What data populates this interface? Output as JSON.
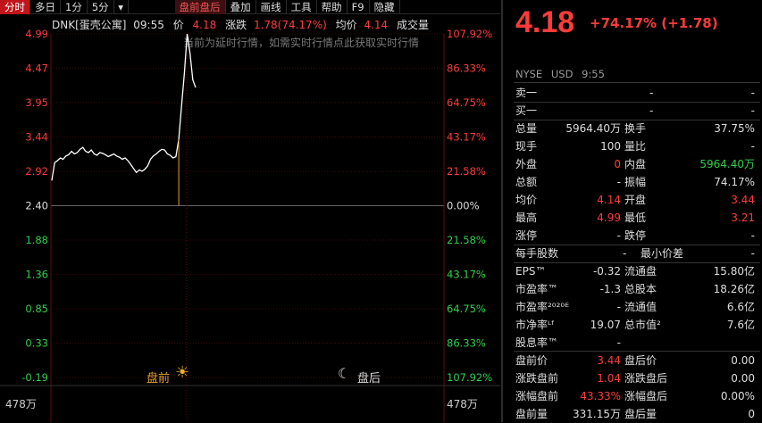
{
  "toolbar": {
    "items": [
      "分时",
      "多日",
      "1分",
      "5分",
      "",
      "盘前盘后",
      "叠加",
      "画线",
      "工具",
      "帮助",
      "F9",
      "隐藏"
    ]
  },
  "chart": {
    "symbol": "DNK[蛋壳公寓]",
    "time": "09:55",
    "price_label": "价",
    "price": "4.18",
    "change_label": "涨跌",
    "change": "1.78(74.17%)",
    "avg_label": "均价",
    "avg": "4.14",
    "vol_label": "成交量",
    "notice": "当前为延时行情，如需实时行情点此获取实时行情",
    "premarket_label": "盘前",
    "afterhours_label": "盘后",
    "vol_max_left": "478万",
    "vol_max_right": "478万",
    "left_ticks": [
      "4.99",
      "4.47",
      "3.95",
      "3.44",
      "2.92",
      "2.40",
      "1.88",
      "1.36",
      "0.85",
      "0.33",
      "-0.19"
    ],
    "right_ticks": [
      "107.92%",
      "86.33%",
      "64.75%",
      "43.17%",
      "21.58%",
      "0.00%",
      "21.58%",
      "43.17%",
      "64.75%",
      "86.33%",
      "107.92%"
    ]
  },
  "chart_data": {
    "type": "line",
    "yrange": [
      -0.19,
      4.99
    ],
    "prev_close": 2.4,
    "series": [
      {
        "values": [
          2.78,
          3.05,
          3.08,
          3.12,
          3.1,
          3.15,
          3.17,
          3.22,
          3.18,
          3.2,
          3.25,
          3.28,
          3.22,
          3.2,
          3.24,
          3.18,
          3.16,
          3.2,
          3.19,
          3.17,
          3.14,
          3.16,
          3.18,
          3.15,
          3.13,
          3.1,
          3.12,
          3.08,
          3.02,
          2.96,
          2.9,
          2.94,
          2.92,
          2.95,
          3.0,
          3.1,
          3.15,
          3.18,
          3.22,
          3.25,
          3.24,
          3.18,
          3.16,
          3.12,
          3.14,
          3.4,
          3.9,
          4.4,
          4.99,
          4.7,
          4.3,
          4.18
        ]
      }
    ]
  },
  "quote": {
    "price": "4.18",
    "change": "+74.17% (+1.78)",
    "exchange": "NYSE",
    "currency": "USD",
    "time": "9:55",
    "sell1_label": "卖一",
    "sell1_a": "-",
    "sell1_b": "-",
    "buy1_label": "买一",
    "buy1_a": "-",
    "buy1_b": "-",
    "rows": [
      {
        "l1": "总量",
        "v1": "5964.40万",
        "c1": "white",
        "l2": "换手",
        "v2": "37.75%",
        "c2": "white"
      },
      {
        "l1": "现手",
        "v1": "100",
        "c1": "white",
        "l2": "量比",
        "v2": "-",
        "c2": "white"
      },
      {
        "l1": "外盘",
        "v1": "0",
        "c1": "red",
        "l2": "内盘",
        "v2": "5964.40万",
        "c2": "green"
      },
      {
        "l1": "总额",
        "v1": "-",
        "c1": "white",
        "l2": "振幅",
        "v2": "74.17%",
        "c2": "white"
      },
      {
        "l1": "均价",
        "v1": "4.14",
        "c1": "red",
        "l2": "开盘",
        "v2": "3.44",
        "c2": "red"
      },
      {
        "l1": "最高",
        "v1": "4.99",
        "c1": "red",
        "l2": "最低",
        "v2": "3.21",
        "c2": "red"
      },
      {
        "l1": "涨停",
        "v1": "-",
        "c1": "white",
        "l2": "跌停",
        "v2": "-",
        "c2": "white"
      }
    ],
    "lot_label": "每手股数",
    "lot_value": "-",
    "tick_label": "最小价差",
    "tick_value": "-",
    "rows2": [
      {
        "l1": "EPS™",
        "v1": "-0.32",
        "l2": "流通盘",
        "v2": "15.80亿"
      },
      {
        "l1": "市盈率™",
        "v1": "-1.3",
        "l2": "总股本",
        "v2": "18.26亿"
      },
      {
        "l1": "市盈率²⁰²⁰ᴱ",
        "v1": "-",
        "l2": "流通值",
        "v2": "6.6亿"
      },
      {
        "l1": "市净率ᴸᶠ",
        "v1": "19.07",
        "l2": "总市值²",
        "v2": "7.6亿"
      },
      {
        "l1": "股息率™",
        "v1": "-",
        "l2": "",
        "v2": ""
      }
    ],
    "rows3": [
      {
        "l1": "盘前价",
        "v1": "3.44",
        "c1": "red",
        "l2": "盘后价",
        "v2": "0.00",
        "c2": "white"
      },
      {
        "l1": "涨跌盘前",
        "v1": "1.04",
        "c1": "red",
        "l2": "涨跌盘后",
        "v2": "0.00",
        "c2": "white"
      },
      {
        "l1": "涨幅盘前",
        "v1": "43.33%",
        "c1": "red",
        "l2": "涨幅盘后",
        "v2": "0.00%",
        "c2": "white"
      },
      {
        "l1": "盘前量",
        "v1": "331.15万",
        "c1": "white",
        "l2": "盘后量",
        "v2": "0",
        "c2": "white"
      }
    ]
  }
}
